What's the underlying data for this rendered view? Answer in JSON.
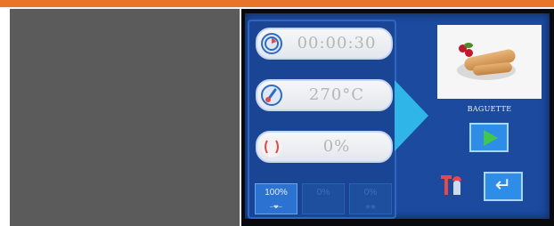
{
  "colors": {
    "top_bar": "#e8742a",
    "screen_bg": "#1b4a9f",
    "arrow": "#2fb5e8",
    "play": "#41c84b",
    "action_button": "#2e8de6"
  },
  "controls": {
    "timer": {
      "icon": "timer-icon",
      "value": "00:00:30"
    },
    "temperature": {
      "icon": "thermometer-icon",
      "value": "270°C"
    },
    "steam": {
      "icon": "steam-icon",
      "value": "0%"
    }
  },
  "fan_buttons": [
    {
      "label": "100%",
      "sub": "~❤~",
      "active": true
    },
    {
      "label": "0%",
      "sub": "",
      "active": false
    },
    {
      "label": "0%",
      "sub": "❄❅",
      "active": false
    }
  ],
  "recipe": {
    "name": "BAGUETTE",
    "image_icon": "baguette-photo"
  },
  "actions": {
    "start_icon": "play-icon",
    "oven_icon": "oven-height-icon",
    "back_icon": "return-arrow-icon",
    "back_glyph": "↵"
  }
}
